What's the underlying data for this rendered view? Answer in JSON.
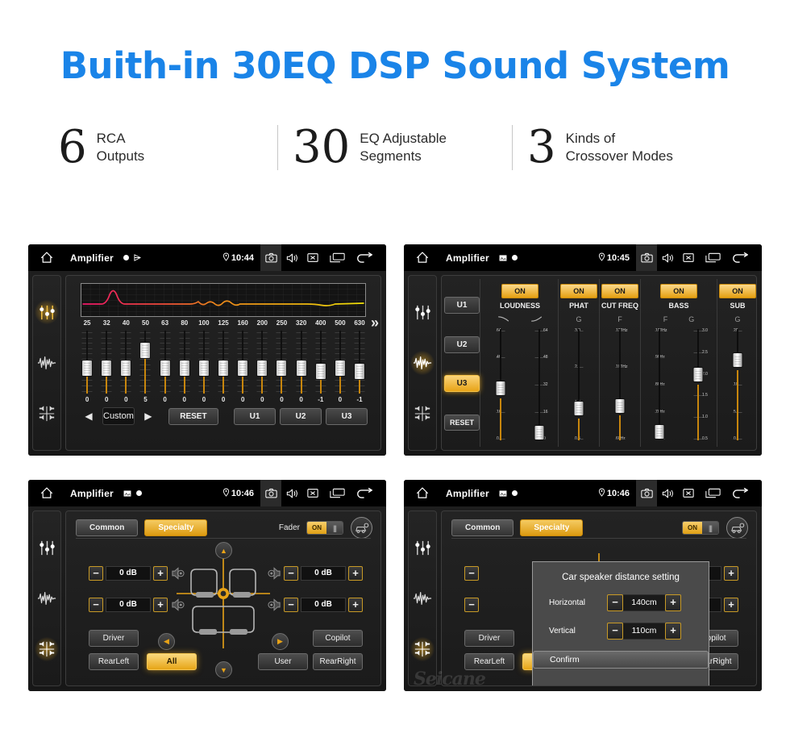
{
  "header": {
    "title": "Buith-in 30EQ DSP Sound System",
    "title_color": "#1a84e8",
    "stats": [
      {
        "number": "6",
        "line1": "RCA",
        "line2": "Outputs"
      },
      {
        "number": "30",
        "line1": "EQ Adjustable",
        "line2": "Segments"
      },
      {
        "number": "3",
        "line1": "Kinds of",
        "line2": "Crossover Modes"
      }
    ]
  },
  "accent_color": "#e8a317",
  "statusbar": {
    "app_title": "Amplifier",
    "icons": [
      "home-icon",
      "location-pin-icon",
      "camera-icon",
      "volume-icon",
      "mute-icon",
      "recent-apps-icon",
      "back-arrow-icon"
    ]
  },
  "sidebar": {
    "items": [
      {
        "name": "equalizer-icon",
        "label": "Equalizer"
      },
      {
        "name": "waveform-icon",
        "label": "Sound Effect"
      },
      {
        "name": "balance-icon",
        "label": "Balance"
      }
    ]
  },
  "screen1": {
    "time": "10:44",
    "active_sidebar": 0,
    "eq": {
      "frequencies": [
        "25",
        "32",
        "40",
        "50",
        "63",
        "80",
        "100",
        "125",
        "160",
        "200",
        "250",
        "320",
        "400",
        "500",
        "630"
      ],
      "values": [
        "0",
        "0",
        "0",
        "5",
        "0",
        "0",
        "0",
        "0",
        "0",
        "0",
        "0",
        "0",
        "-1",
        "0",
        "-1"
      ],
      "numeric_values": [
        0,
        0,
        0,
        5,
        0,
        0,
        0,
        0,
        0,
        0,
        0,
        0,
        -1,
        0,
        -1
      ],
      "expand_icon": "»"
    },
    "controls": {
      "prev_icon": "◀",
      "preset_name": "Custom",
      "next_icon": "▶",
      "reset_label": "RESET",
      "user_presets": [
        "U1",
        "U2",
        "U3"
      ]
    }
  },
  "screen2": {
    "time": "10:45",
    "active_sidebar": 1,
    "user_buttons": [
      {
        "label": "U1",
        "active": false
      },
      {
        "label": "U2",
        "active": false
      },
      {
        "label": "U3",
        "active": true
      }
    ],
    "reset_label": "RESET",
    "sections": [
      {
        "name": "LOUDNESS",
        "toggle": "ON",
        "sub_labels": [
          "curve-down-icon",
          "curve-up-icon"
        ],
        "sliders": [
          {
            "scale": [
              "64",
              "48",
              "32",
              "16",
              "0"
            ],
            "value_pct": 48,
            "side": "left"
          },
          {
            "scale": [
              "64",
              "48",
              "32",
              "16",
              "0"
            ],
            "value_pct": 4,
            "side": "right"
          }
        ]
      },
      {
        "name": "PHAT",
        "toggle": "ON",
        "sub_labels": [
          "G"
        ],
        "sliders": [
          {
            "scale": [
              "3.0",
              "2.1",
              "1.3",
              "0.5"
            ],
            "value_pct": 28,
            "side": "left"
          }
        ]
      },
      {
        "name": "CUT FREQ",
        "toggle": "ON",
        "sub_labels": [
          "F"
        ],
        "sliders": [
          {
            "scale": [
              "120Hz",
              "100Hz",
              "80Hz",
              "60Hz"
            ],
            "value_pct": 31,
            "side": "left"
          }
        ]
      },
      {
        "name": "BASS",
        "toggle": "ON",
        "sub_labels": [
          "F",
          "G"
        ],
        "sliders": [
          {
            "scale": [
              "100Hz",
              "90Hz",
              "80Hz",
              "70Hz",
              "60Hz"
            ],
            "value_pct": 5,
            "side": "left"
          },
          {
            "scale": [
              "3.0",
              "2.5",
              "2.0",
              "1.5",
              "1.0",
              "0.5"
            ],
            "value_pct": 62,
            "side": "right"
          }
        ]
      },
      {
        "name": "SUB",
        "toggle": "ON",
        "sub_labels": [
          "G"
        ],
        "sliders": [
          {
            "scale": [
              "20",
              "15",
              "10",
              "5",
              "0"
            ],
            "value_pct": 76,
            "side": "left"
          }
        ]
      }
    ]
  },
  "screen3": {
    "time": "10:46",
    "active_sidebar": 2,
    "tabs": [
      {
        "label": "Common",
        "active": false
      },
      {
        "label": "Specialty",
        "active": true
      }
    ],
    "fader": {
      "label": "Fader",
      "toggle": "ON"
    },
    "car_setting_icon": "car-speaker-icon",
    "speaker_levels": [
      {
        "position": "front-left",
        "value": "0 dB"
      },
      {
        "position": "front-right",
        "value": "0 dB"
      },
      {
        "position": "rear-left",
        "value": "0 dB"
      },
      {
        "position": "rear-right",
        "value": "0 dB"
      }
    ],
    "minus_icon": "−",
    "plus_icon": "+",
    "seat_buttons": [
      {
        "label": "Driver",
        "active": false
      },
      {
        "label": "Copilot",
        "active": false
      },
      {
        "label": "RearLeft",
        "active": false
      },
      {
        "label": "All",
        "active": true
      },
      {
        "label": "User",
        "active": false
      },
      {
        "label": "RearRight",
        "active": false
      }
    ],
    "nav_icons": [
      "up-arrow-icon",
      "left-arrow-icon",
      "right-arrow-icon",
      "down-arrow-icon"
    ]
  },
  "screen4": {
    "time": "10:46",
    "active_sidebar": 2,
    "dialog": {
      "title": "Car speaker distance setting",
      "rows": [
        {
          "label": "Horizontal",
          "value": "140cm"
        },
        {
          "label": "Vertical",
          "value": "110cm"
        }
      ],
      "minus_icon": "−",
      "plus_icon": "+",
      "confirm_label": "Confirm"
    },
    "watermark": "Seicane"
  }
}
